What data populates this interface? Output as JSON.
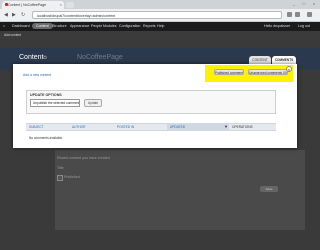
{
  "browser": {
    "tab_title": "Content | NoCoffeePage",
    "url": "localhost/drupal7/content#overlay=admin/content",
    "window_controls": {
      "minimize": "_",
      "maximize": "□",
      "close": "×"
    }
  },
  "toolbar": {
    "items": [
      "Dashboard",
      "Content",
      "Structure",
      "Appearance",
      "People",
      "Modules",
      "Configuration",
      "Reports",
      "Help"
    ],
    "user": "Hello drupaluser",
    "logout": "Log out",
    "shortcuts": "Add content"
  },
  "page": {
    "title": "Content",
    "title_ghost": "NoCoffeePage",
    "tabs": [
      "CONTENT",
      "COMMENTS"
    ]
  },
  "overlay": {
    "add_link": "Add a new content",
    "actions": [
      "Published comments",
      "Unapproved comments (0)"
    ],
    "close_label": "x",
    "update": {
      "legend": "UPDATE OPTIONS",
      "select_value": "Unpublish the selected comments",
      "button": "Update"
    },
    "table": {
      "columns": [
        "Subject",
        "Author",
        "Posted in",
        "Updated",
        "Operations"
      ],
      "sorted_column": "Updated",
      "empty_text": "No comments available."
    }
  },
  "background": {
    "text_lines": [
      "Recent content you have created",
      "Title",
      "Published"
    ],
    "button": "Save"
  },
  "colors": {
    "highlight": "#fff100",
    "link": "#2a6bb5",
    "toolbar_bg": "#1b1b1b"
  }
}
